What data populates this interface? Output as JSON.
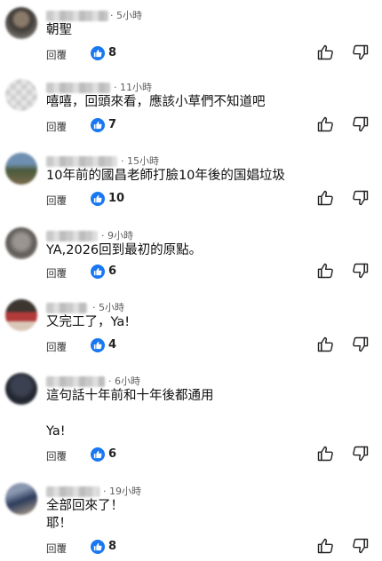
{
  "reply_label": "回覆",
  "icons": {
    "like_badge": "thumbs-up-badge-icon",
    "like_button": "thumbs-up-outline-icon",
    "dislike_button": "thumbs-down-outline-icon"
  },
  "colors": {
    "like_badge": "#1877f2",
    "time": "#606060"
  },
  "comments": [
    {
      "time": "· 5小時",
      "text": "朝聖",
      "likes": "8"
    },
    {
      "time": "· 11小時",
      "text": "嘻嘻，回頭來看，應該小草們不知道吧",
      "likes": "7"
    },
    {
      "time": "· 15小時",
      "text": "10年前的國昌老師打臉10年後的国娼垃圾",
      "likes": "10"
    },
    {
      "time": "· 9小時",
      "text": "YA,2026回到最初的原點。",
      "likes": "6"
    },
    {
      "time": "· 5小時",
      "text": "又完工了，Ya!",
      "likes": "4"
    },
    {
      "time": "· 6小時",
      "text": "這句話十年前和十年後都通用\n\nYa!",
      "likes": "6"
    },
    {
      "time": "· 19小時",
      "text": "全部回來了！\n耶！",
      "likes": "8"
    }
  ]
}
